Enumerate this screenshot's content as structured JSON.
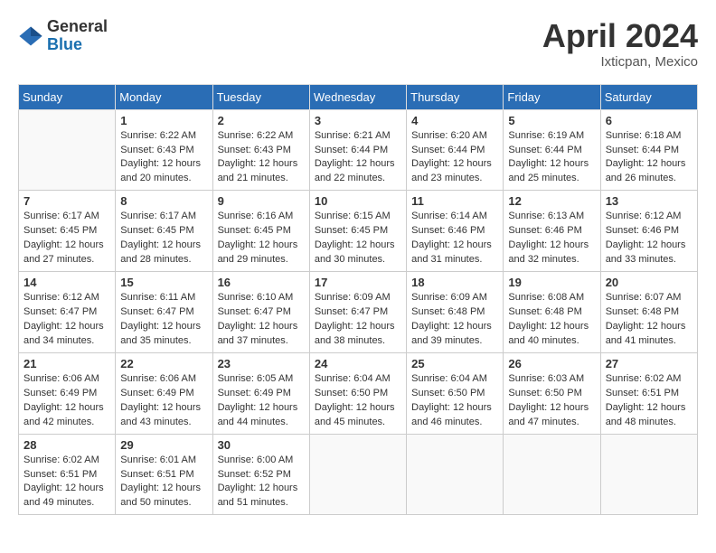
{
  "logo": {
    "general": "General",
    "blue": "Blue"
  },
  "title": {
    "month_year": "April 2024",
    "location": "Ixticpan, Mexico"
  },
  "weekdays": [
    "Sunday",
    "Monday",
    "Tuesday",
    "Wednesday",
    "Thursday",
    "Friday",
    "Saturday"
  ],
  "weeks": [
    [
      {
        "day": "",
        "info": ""
      },
      {
        "day": "1",
        "info": "Sunrise: 6:22 AM\nSunset: 6:43 PM\nDaylight: 12 hours\nand 20 minutes."
      },
      {
        "day": "2",
        "info": "Sunrise: 6:22 AM\nSunset: 6:43 PM\nDaylight: 12 hours\nand 21 minutes."
      },
      {
        "day": "3",
        "info": "Sunrise: 6:21 AM\nSunset: 6:44 PM\nDaylight: 12 hours\nand 22 minutes."
      },
      {
        "day": "4",
        "info": "Sunrise: 6:20 AM\nSunset: 6:44 PM\nDaylight: 12 hours\nand 23 minutes."
      },
      {
        "day": "5",
        "info": "Sunrise: 6:19 AM\nSunset: 6:44 PM\nDaylight: 12 hours\nand 25 minutes."
      },
      {
        "day": "6",
        "info": "Sunrise: 6:18 AM\nSunset: 6:44 PM\nDaylight: 12 hours\nand 26 minutes."
      }
    ],
    [
      {
        "day": "7",
        "info": "Sunrise: 6:17 AM\nSunset: 6:45 PM\nDaylight: 12 hours\nand 27 minutes."
      },
      {
        "day": "8",
        "info": "Sunrise: 6:17 AM\nSunset: 6:45 PM\nDaylight: 12 hours\nand 28 minutes."
      },
      {
        "day": "9",
        "info": "Sunrise: 6:16 AM\nSunset: 6:45 PM\nDaylight: 12 hours\nand 29 minutes."
      },
      {
        "day": "10",
        "info": "Sunrise: 6:15 AM\nSunset: 6:45 PM\nDaylight: 12 hours\nand 30 minutes."
      },
      {
        "day": "11",
        "info": "Sunrise: 6:14 AM\nSunset: 6:46 PM\nDaylight: 12 hours\nand 31 minutes."
      },
      {
        "day": "12",
        "info": "Sunrise: 6:13 AM\nSunset: 6:46 PM\nDaylight: 12 hours\nand 32 minutes."
      },
      {
        "day": "13",
        "info": "Sunrise: 6:12 AM\nSunset: 6:46 PM\nDaylight: 12 hours\nand 33 minutes."
      }
    ],
    [
      {
        "day": "14",
        "info": "Sunrise: 6:12 AM\nSunset: 6:47 PM\nDaylight: 12 hours\nand 34 minutes."
      },
      {
        "day": "15",
        "info": "Sunrise: 6:11 AM\nSunset: 6:47 PM\nDaylight: 12 hours\nand 35 minutes."
      },
      {
        "day": "16",
        "info": "Sunrise: 6:10 AM\nSunset: 6:47 PM\nDaylight: 12 hours\nand 37 minutes."
      },
      {
        "day": "17",
        "info": "Sunrise: 6:09 AM\nSunset: 6:47 PM\nDaylight: 12 hours\nand 38 minutes."
      },
      {
        "day": "18",
        "info": "Sunrise: 6:09 AM\nSunset: 6:48 PM\nDaylight: 12 hours\nand 39 minutes."
      },
      {
        "day": "19",
        "info": "Sunrise: 6:08 AM\nSunset: 6:48 PM\nDaylight: 12 hours\nand 40 minutes."
      },
      {
        "day": "20",
        "info": "Sunrise: 6:07 AM\nSunset: 6:48 PM\nDaylight: 12 hours\nand 41 minutes."
      }
    ],
    [
      {
        "day": "21",
        "info": "Sunrise: 6:06 AM\nSunset: 6:49 PM\nDaylight: 12 hours\nand 42 minutes."
      },
      {
        "day": "22",
        "info": "Sunrise: 6:06 AM\nSunset: 6:49 PM\nDaylight: 12 hours\nand 43 minutes."
      },
      {
        "day": "23",
        "info": "Sunrise: 6:05 AM\nSunset: 6:49 PM\nDaylight: 12 hours\nand 44 minutes."
      },
      {
        "day": "24",
        "info": "Sunrise: 6:04 AM\nSunset: 6:50 PM\nDaylight: 12 hours\nand 45 minutes."
      },
      {
        "day": "25",
        "info": "Sunrise: 6:04 AM\nSunset: 6:50 PM\nDaylight: 12 hours\nand 46 minutes."
      },
      {
        "day": "26",
        "info": "Sunrise: 6:03 AM\nSunset: 6:50 PM\nDaylight: 12 hours\nand 47 minutes."
      },
      {
        "day": "27",
        "info": "Sunrise: 6:02 AM\nSunset: 6:51 PM\nDaylight: 12 hours\nand 48 minutes."
      }
    ],
    [
      {
        "day": "28",
        "info": "Sunrise: 6:02 AM\nSunset: 6:51 PM\nDaylight: 12 hours\nand 49 minutes."
      },
      {
        "day": "29",
        "info": "Sunrise: 6:01 AM\nSunset: 6:51 PM\nDaylight: 12 hours\nand 50 minutes."
      },
      {
        "day": "30",
        "info": "Sunrise: 6:00 AM\nSunset: 6:52 PM\nDaylight: 12 hours\nand 51 minutes."
      },
      {
        "day": "",
        "info": ""
      },
      {
        "day": "",
        "info": ""
      },
      {
        "day": "",
        "info": ""
      },
      {
        "day": "",
        "info": ""
      }
    ]
  ]
}
